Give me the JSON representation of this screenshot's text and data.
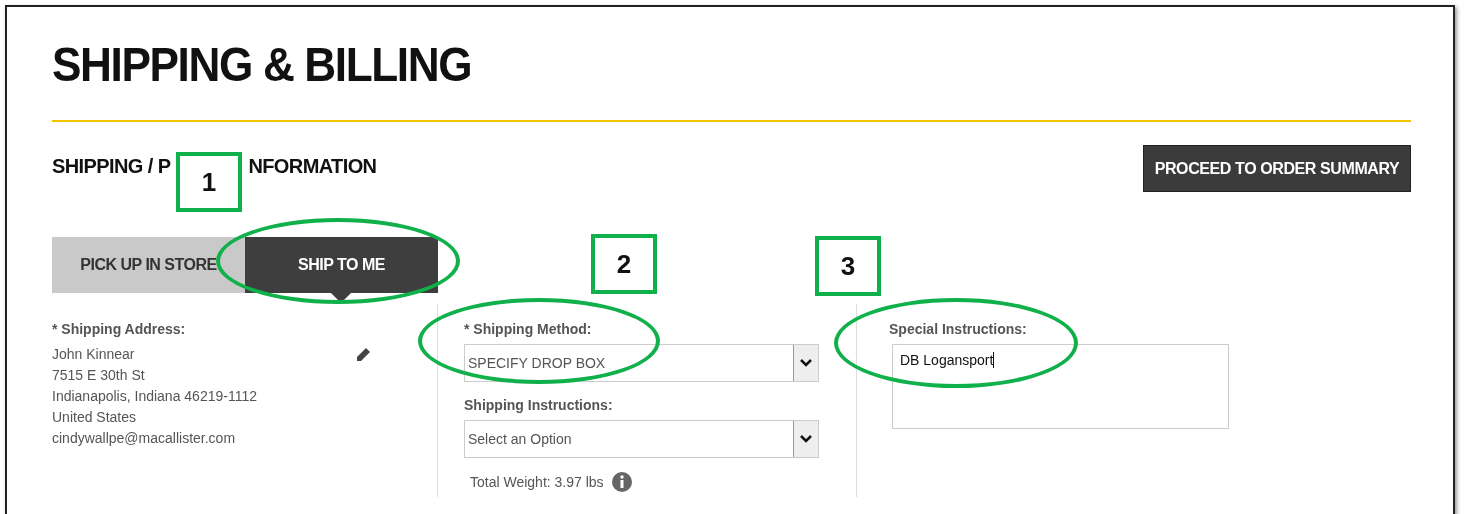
{
  "page_title": "SHIPPING & BILLING",
  "section": {
    "heading_parts": [
      "SHIPPING / P",
      "NFORMATION"
    ]
  },
  "proceed_button": "PROCEED TO ORDER SUMMARY",
  "tabs": [
    {
      "label": "PICK UP IN STORE",
      "selected": false
    },
    {
      "label": "SHIP TO ME",
      "selected": true
    }
  ],
  "address": {
    "label": "* Shipping Address:",
    "lines": [
      "John Kinnear",
      "7515 E 30th St",
      "Indianapolis, Indiana 46219-1112",
      "United States",
      "cindywallpe@macallister.com"
    ]
  },
  "shipping_method": {
    "label": "* Shipping Method:",
    "value": "SPECIFY DROP BOX"
  },
  "shipping_instructions": {
    "label": "Shipping Instructions:",
    "value": "Select an Option"
  },
  "total_weight": "Total Weight: 3.97 lbs",
  "special_instructions": {
    "label": "Special Instructions:",
    "value": "DB Logansport"
  },
  "annotations": [
    {
      "number": "1"
    },
    {
      "number": "2"
    },
    {
      "number": "3"
    }
  ]
}
